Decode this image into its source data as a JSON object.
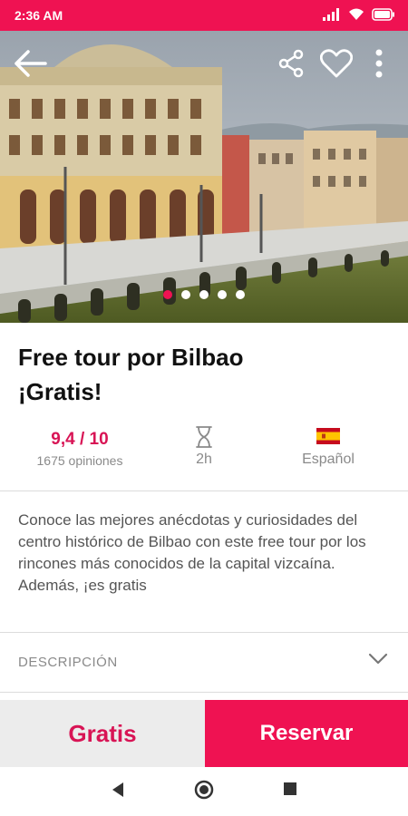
{
  "status_bar": {
    "time": "2:36 AM",
    "icons": [
      "signal-icon",
      "wifi-icon",
      "battery-icon"
    ]
  },
  "hero": {
    "image": "bilbao-building-riverside-photo",
    "slide_count": 5,
    "active_slide": 1,
    "actions": [
      "back-arrow-icon",
      "share-icon",
      "heart-icon",
      "more-vert-icon"
    ]
  },
  "tour": {
    "title_line1": "Free tour por Bilbao",
    "title_line2": "¡Gratis!",
    "rating": "9,4 / 10",
    "reviews": "1675 opiniones",
    "duration": "2h",
    "language": "Español",
    "description": "Conoce las mejores anécdotas y curiosidades del centro histórico de Bilbao con este free tour por los rincones más conocidos de la capital vizcaína. Además, ¡es gratis"
  },
  "sections": {
    "description_label": "DESCRIPCIÓN"
  },
  "footer": {
    "price_label": "Gratis",
    "book_label": "Reservar"
  },
  "colors": {
    "accent": "#ef1252",
    "rating": "#d81455",
    "muted": "#8a8a8a"
  }
}
